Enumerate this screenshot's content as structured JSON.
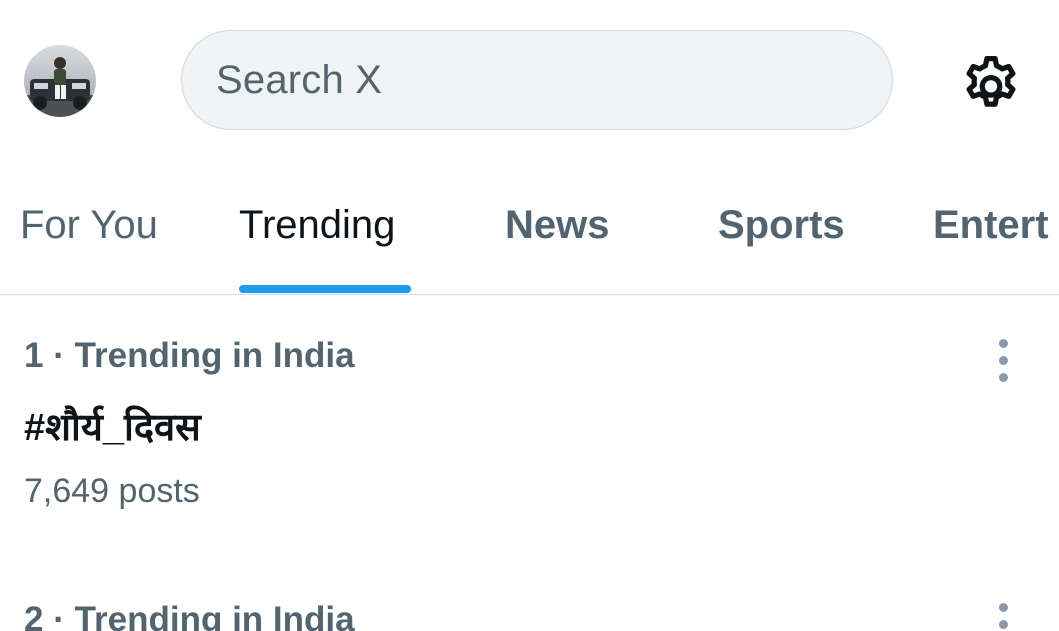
{
  "header": {
    "search_placeholder": "Search X"
  },
  "tabs": [
    {
      "label": "For You"
    },
    {
      "label": "Trending"
    },
    {
      "label": "News"
    },
    {
      "label": "Sports"
    },
    {
      "label": "Entert"
    }
  ],
  "active_tab": "Trending",
  "trends": [
    {
      "meta": "1 · Trending in India",
      "title": "#शौर्य_दिवस",
      "count": "7,649 posts"
    },
    {
      "meta": "2 · Trending in India"
    }
  ],
  "colors": {
    "accent": "#1d9bf0",
    "text_primary": "#0f1419",
    "text_secondary": "#536471",
    "search_bg": "#eff3f4"
  }
}
